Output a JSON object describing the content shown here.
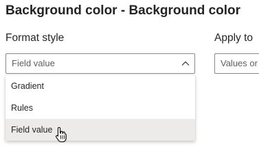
{
  "header": {
    "title": "Background color - Background color"
  },
  "format_style": {
    "label": "Format style",
    "value": "Field value",
    "options": [
      {
        "label": "Gradient",
        "selected": false
      },
      {
        "label": "Rules",
        "selected": false
      },
      {
        "label": "Field value",
        "selected": true
      }
    ]
  },
  "apply_to": {
    "label": "Apply to",
    "value": "Values or"
  },
  "icons": {
    "chevron": "chevron-up-icon",
    "cursor": "hand-pointer-icon"
  }
}
